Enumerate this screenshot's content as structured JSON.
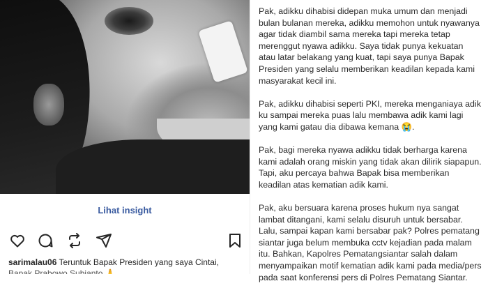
{
  "post": {
    "insight_label": "Lihat insight",
    "caption": {
      "username": "sarimalau06",
      "text": "Teruntuk Bapak Presiden yang saya Cintai,",
      "text_line2": "Bapak Prabowo Subianto 🙏"
    },
    "actions": [
      "heart-icon",
      "comment-icon",
      "repost-icon",
      "share-icon",
      "bookmark-icon"
    ]
  },
  "article": {
    "paragraphs": [
      "Pak, adikku dihabisi didepan muka umum dan menjadi bulan bulanan mereka, adikku memohon untuk nyawanya agar tidak diambil sama mereka tapi mereka tetap merenggut nyawa adikku. Saya tidak punya kekuatan atau latar belakang yang kuat, tapi saya punya Bapak Presiden yang selalu memberikan keadilan kepada kami masyarakat kecil ini.",
      "Pak, adikku dihabisi seperti PKI, mereka menganiaya adik ku sampai mereka puas lalu membawa adik kami lagi yang kami gatau dia dibawa kemana 😭.",
      "Pak, bagi mereka nyawa adikku tidak berharga karena kami adalah orang miskin yang tidak akan dilirik siapapun. Tapi, aku percaya bahwa Bapak bisa memberikan keadilan atas kematian adik kami.",
      "Pak, aku bersuara karena proses hukum nya sangat lambat ditangani, kami selalu disuruh untuk bersabar. Lalu, sampai kapan kami bersabar pak? Polres pematang siantar juga belum membuka cctv kejadian pada malam itu. Bahkan, Kapolres Pematangsiantar salah dalam menyampaikan motif kematian adik kami pada media/pers pada saat konferensi pers di Polres Pematang Siantar."
    ]
  }
}
